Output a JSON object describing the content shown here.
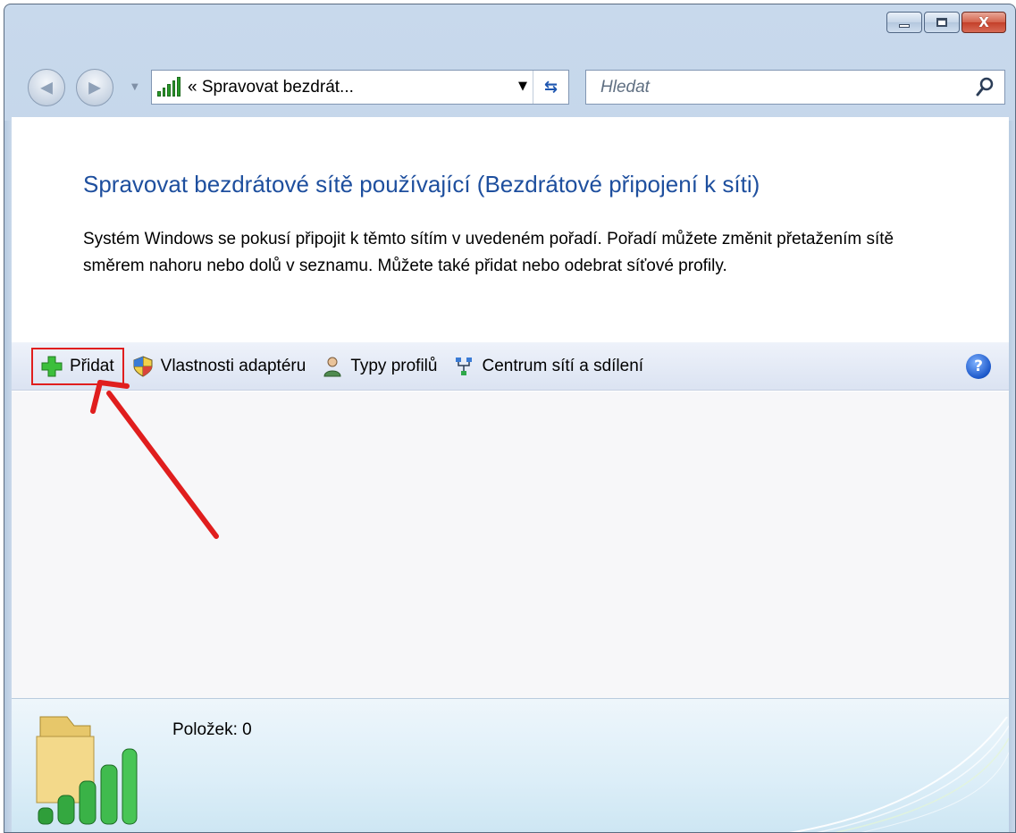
{
  "window": {
    "minimize_label": "minimize",
    "maximize_label": "maximize",
    "close_glyph": "X"
  },
  "navigation": {
    "address_text": "« Spravovat bezdrát...",
    "search_placeholder": "Hledat",
    "refresh_glyph": "⇆"
  },
  "main": {
    "title": "Spravovat bezdrátové sítě používající (Bezdrátové připojení k síti)",
    "description": "Systém Windows se pokusí připojit k těmto sítím v uvedeném pořadí. Pořadí můžete změnit přetažením sítě směrem nahoru nebo dolů v seznamu. Můžete také přidat nebo odebrat síťové profily."
  },
  "toolbar": {
    "add_label": "Přidat",
    "adapter_props_label": "Vlastnosti adaptéru",
    "profile_types_label": "Typy profilů",
    "network_center_label": "Centrum sítí a sdílení",
    "help_glyph": "?"
  },
  "details": {
    "items_count_text": "Položek: 0"
  },
  "colors": {
    "heading": "#1e4f9e",
    "annotation": "#e01e1e"
  }
}
